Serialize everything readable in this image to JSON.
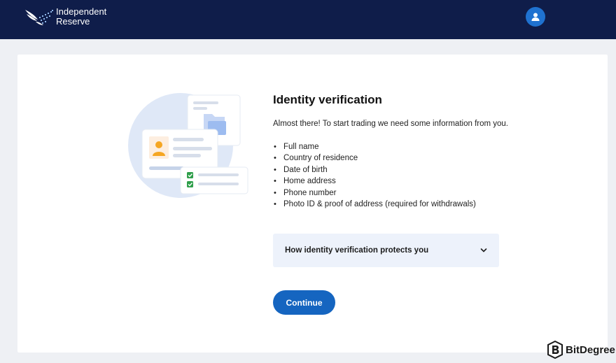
{
  "header": {
    "logo_line1": "Independent",
    "logo_line2": "Reserve",
    "colors": {
      "navbar": "#0f1d4a",
      "avatar": "#1f72d0"
    }
  },
  "main": {
    "title": "Identity verification",
    "intro": "Almost there! To start trading we need some information from you.",
    "requirements": [
      "Full name",
      "Country of residence",
      "Date of birth",
      "Home address",
      "Phone number",
      "Photo ID & proof of address (required for withdrawals)"
    ],
    "accordion_label": "How identity verification protects you",
    "continue_label": "Continue"
  },
  "watermark": {
    "text": "BitDegree"
  },
  "icons": [
    "logo-wing-icon",
    "user-avatar-icon",
    "chevron-down-icon",
    "bitdegree-logo-icon"
  ],
  "colors": {
    "accent": "#1565c0",
    "accordion_bg": "#edf2fb",
    "page_bg": "#eef0f4"
  }
}
